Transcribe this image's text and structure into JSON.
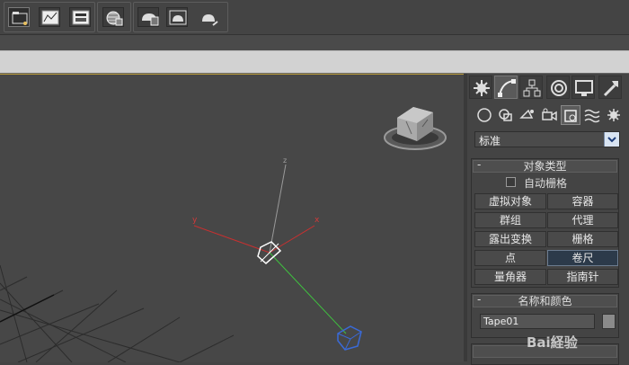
{
  "toolbar": {
    "buttons": [
      "open-file-icon",
      "graph-editor-icon",
      "render-setup-icon",
      "material-editor-icon",
      "render-frame-icon",
      "render-production-icon",
      "render-active-icon"
    ]
  },
  "viewport": {
    "axis_x_label": "x",
    "axis_y_label": "y",
    "axis_z_label": "z",
    "colors": {
      "x_axis": "#c83030",
      "y_axis": "#3fc23f",
      "z_axis": "#b0b0b0",
      "box": "#3a6ad8"
    }
  },
  "panel": {
    "tabs": [
      "create-icon",
      "modify-icon",
      "hierarchy-icon",
      "motion-icon",
      "display-icon",
      "utilities-icon"
    ],
    "subtabs": [
      "geometry-icon",
      "shapes-icon",
      "lights-icon",
      "cameras-icon",
      "helpers-icon",
      "space-warps-icon",
      "systems-icon"
    ],
    "dropdown_value": "标准",
    "object_type": {
      "title": "对象类型",
      "minus": "-",
      "autogrid_label": "自动栅格",
      "buttons": [
        "虚拟对象",
        "容器",
        "群组",
        "代理",
        "露出变换",
        "栅格",
        "点",
        "卷尺",
        "量角器",
        "指南针"
      ],
      "active_button": "卷尺"
    },
    "name_color": {
      "title": "名称和颜色",
      "minus": "-",
      "name_value": "Tape01",
      "swatch_color": "#8a8a8a"
    }
  },
  "watermark": "Bai経验"
}
